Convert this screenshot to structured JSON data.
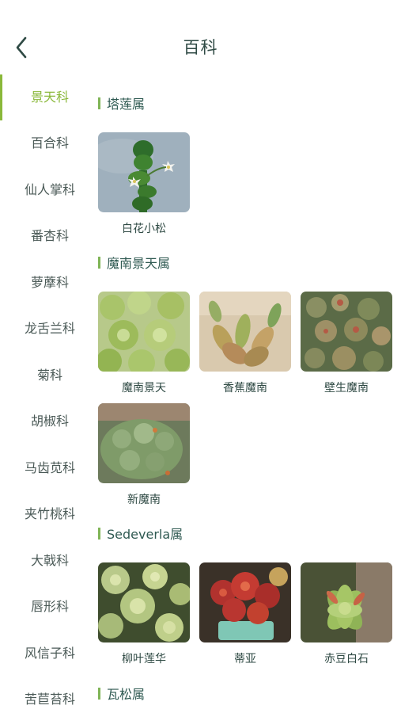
{
  "header": {
    "title": "百科",
    "back_icon": "chevron-left-icon"
  },
  "sidebar": {
    "active_color": "#8ab83a",
    "items": [
      {
        "label": "景天科",
        "active": true
      },
      {
        "label": "百合科"
      },
      {
        "label": "仙人掌科"
      },
      {
        "label": "番杏科"
      },
      {
        "label": "萝藦科"
      },
      {
        "label": "龙舌兰科"
      },
      {
        "label": "菊科"
      },
      {
        "label": "胡椒科"
      },
      {
        "label": "马齿苋科"
      },
      {
        "label": "夹竹桃科"
      },
      {
        "label": "大戟科"
      },
      {
        "label": "唇形科"
      },
      {
        "label": "风信子科"
      },
      {
        "label": "苦苣苔科"
      }
    ]
  },
  "content": {
    "sections": [
      {
        "title": "塔莲属",
        "plants": [
          {
            "name": "白花小松"
          }
        ]
      },
      {
        "title": "魔南景天属",
        "plants": [
          {
            "name": "魔南景天"
          },
          {
            "name": "香蕉魔南"
          },
          {
            "name": "壁生魔南"
          },
          {
            "name": "新魔南"
          }
        ]
      },
      {
        "title": "Sedeverla属",
        "plants": [
          {
            "name": "柳叶莲华"
          },
          {
            "name": "蒂亚"
          },
          {
            "name": "赤豆白石"
          }
        ]
      },
      {
        "title": "瓦松属",
        "plants": []
      }
    ]
  }
}
